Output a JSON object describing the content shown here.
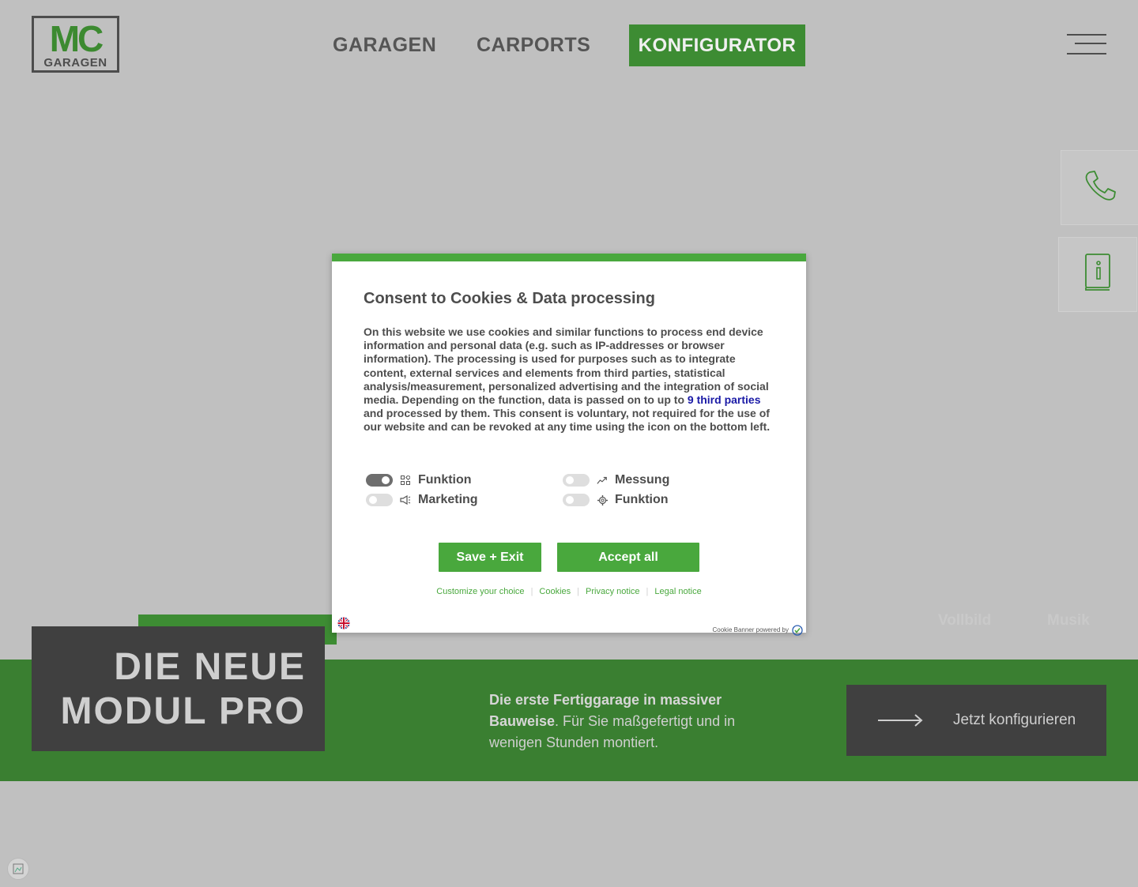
{
  "logo": {
    "mc": "MC",
    "sub": "GARAGEN"
  },
  "nav": {
    "garagen": "GARAGEN",
    "carports": "CARPORTS",
    "konfigurator": "KONFIGURATOR"
  },
  "colors": {
    "brand_green": "#3d8c33",
    "band_green": "#3a7f31",
    "dark_box": "#404040",
    "modal_green": "#49a83d"
  },
  "side_buttons": {
    "phone_icon": "phone-icon",
    "info_icon": "info-book-icon"
  },
  "hero": {
    "title_line1": "DIE NEUE",
    "title_line2": "MODUL PRO",
    "vollbild": "Vollbild",
    "musik": "Musik",
    "text_bold": "Die erste Fertiggarage in massiver Bauweise",
    "text_rest": ". Für Sie maßgefertigt und in wenigen Stunden montiert.",
    "cta": "Jetzt konfigurieren"
  },
  "cookie": {
    "title": "Consent to Cookies & Data processing",
    "text_part1": "On this website we use cookies and similar functions to process end device information and personal data (e.g. such as IP-addresses or browser information). The processing is used for purposes such as to integrate content, external services and elements from third parties, statistical analysis/measurement, personalized advertising and the integration of social media. Depending on the function, data is passed on to up to ",
    "third_parties_link": "9 third parties",
    "text_part2": " and processed by them. This consent is voluntary, not required for the use of our website and can be revoked at any time using the icon on the bottom left.",
    "options": [
      {
        "label": "Funktion",
        "state": "on",
        "icon": "grid-icon"
      },
      {
        "label": "Messung",
        "state": "off",
        "icon": "chart-trend-icon"
      },
      {
        "label": "Marketing",
        "state": "off",
        "icon": "megaphone-icon"
      },
      {
        "label": "Funktion",
        "state": "off",
        "icon": "gear-icon"
      }
    ],
    "save_exit": "Save + Exit",
    "accept_all": "Accept all",
    "links": [
      "Customize your choice",
      "Cookies",
      "Privacy notice",
      "Legal notice"
    ],
    "powered_by": "Cookie Banner powered by",
    "language_flag": "uk-flag-icon"
  }
}
